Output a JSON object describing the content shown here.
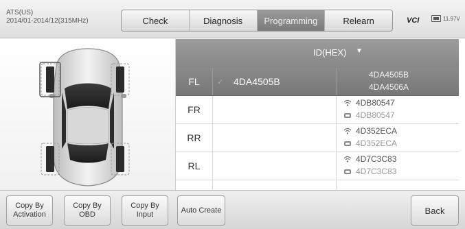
{
  "header": {
    "vehicle_line1": "ATS(US)",
    "vehicle_line2": "2014/01-2014/12(315MHz)",
    "tabs": [
      {
        "label": "Check",
        "active": false
      },
      {
        "label": "Diagnosis",
        "active": false
      },
      {
        "label": "Programming",
        "active": true
      },
      {
        "label": "Relearn",
        "active": false
      }
    ],
    "vci_label": "VCI",
    "battery_text": "11.97V"
  },
  "car_panel": {
    "selected_wheel": "FL"
  },
  "table": {
    "column_header": "ID(HEX)",
    "header_caret": "▼",
    "rows": [
      {
        "position": "FL",
        "programmed_id": "4DA4505B",
        "check_mark": "✓",
        "sensor_id": "4DA4505B",
        "obd_id": "4DA4506A",
        "selected": true
      },
      {
        "position": "FR",
        "programmed_id": "",
        "check_mark": "",
        "sensor_id": "4DB80547",
        "obd_id": "4DB80547",
        "selected": false
      },
      {
        "position": "RR",
        "programmed_id": "",
        "check_mark": "",
        "sensor_id": "4D352ECA",
        "obd_id": "4D352ECA",
        "selected": false
      },
      {
        "position": "RL",
        "programmed_id": "",
        "check_mark": "",
        "sensor_id": "4D7C3C83",
        "obd_id": "4D7C3C83",
        "selected": false
      }
    ],
    "icons": {
      "sensor": "wireless-icon",
      "obd": "obd-icon"
    }
  },
  "bottom_bar": {
    "copy_activation": "Copy By\nActivation",
    "copy_obd": "Copy By\nOBD",
    "copy_input": "Copy By\nInput",
    "auto_create": "Auto Create",
    "back": "Back"
  }
}
